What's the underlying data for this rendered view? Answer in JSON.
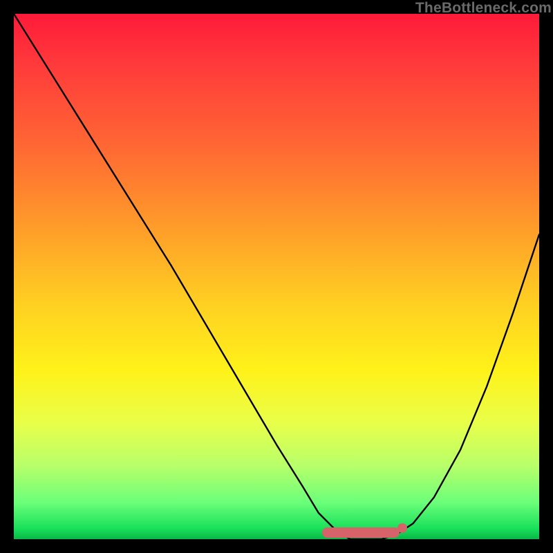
{
  "watermark": "TheBottleneck.com",
  "chart_data": {
    "type": "line",
    "title": "",
    "xlabel": "",
    "ylabel": "",
    "xlim": [
      0,
      100
    ],
    "ylim": [
      0,
      100
    ],
    "grid": false,
    "legend": false,
    "series": [
      {
        "name": "curve",
        "x": [
          0,
          10,
          20,
          30,
          40,
          50,
          55,
          58,
          61,
          64,
          67,
          70,
          73,
          76,
          80,
          85,
          90,
          95,
          100
        ],
        "y": [
          100,
          84,
          68,
          52,
          35,
          18,
          10,
          5,
          2,
          0,
          0,
          0,
          1,
          3,
          8,
          17,
          29,
          43,
          58
        ]
      }
    ],
    "annotations": [
      {
        "name": "optimal-band",
        "shape": "capsule",
        "x_range": [
          58,
          74
        ],
        "y": 0,
        "color": "#d7636a"
      }
    ],
    "background_gradient": {
      "direction": "vertical",
      "stops": [
        {
          "pos": 0,
          "color": "#ff1a3a"
        },
        {
          "pos": 40,
          "color": "#ff9a2a"
        },
        {
          "pos": 68,
          "color": "#fff21a"
        },
        {
          "pos": 100,
          "color": "#08b848"
        }
      ]
    }
  }
}
